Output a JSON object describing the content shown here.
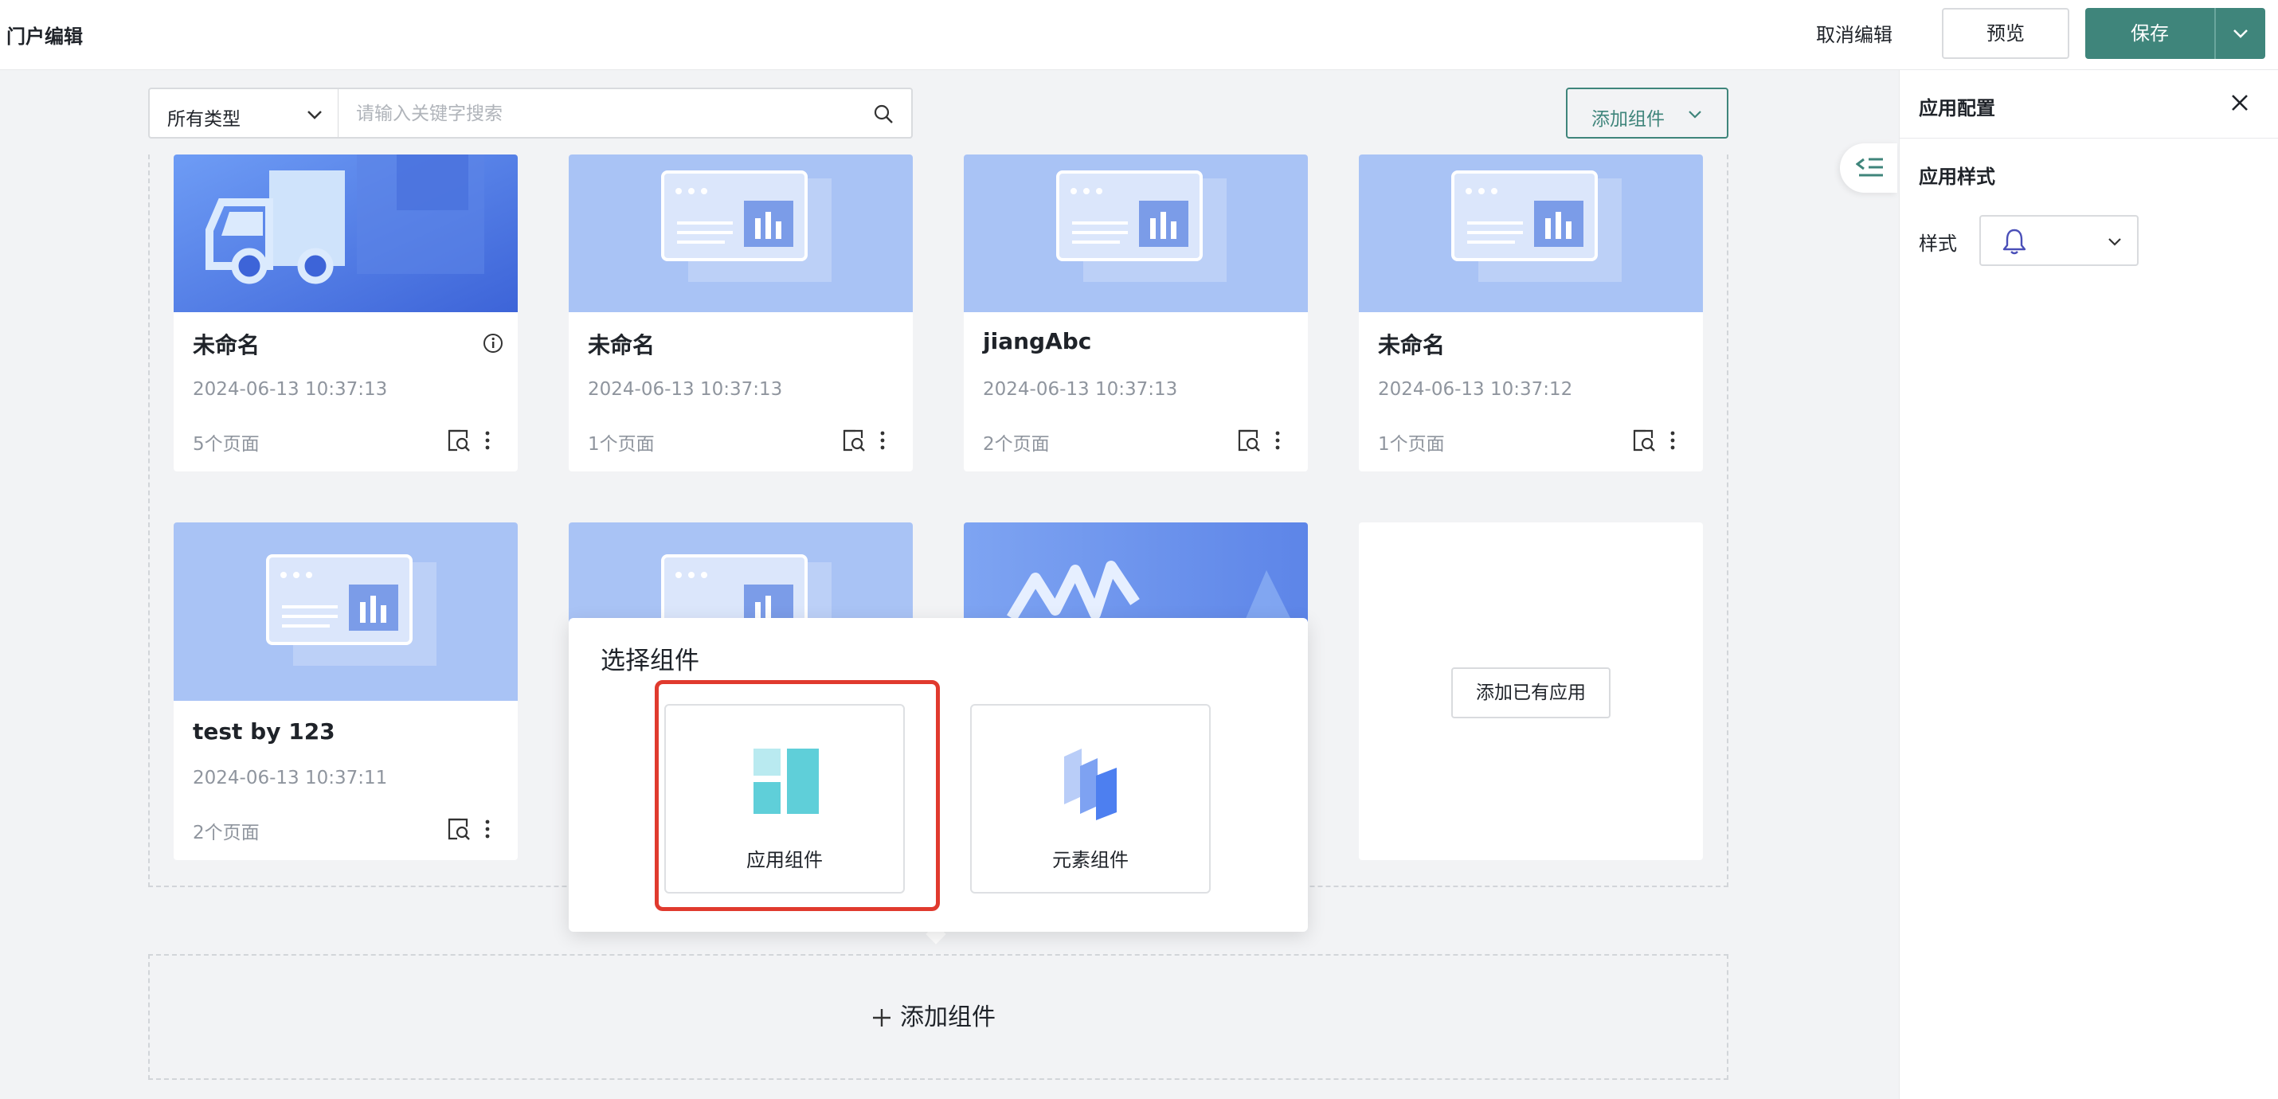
{
  "header": {
    "title": "门户编辑",
    "cancel_label": "取消编辑",
    "preview_label": "预览",
    "save_label": "保存"
  },
  "filter": {
    "type_selected": "所有类型",
    "search_placeholder": "请输入关键字搜索",
    "add_component_label": "添加组件"
  },
  "cards": [
    {
      "name": "未命名",
      "time": "2024-06-13 10:37:13",
      "pages": "5个页面",
      "thumb": "truck"
    },
    {
      "name": "未命名",
      "time": "2024-06-13 10:37:13",
      "pages": "1个页面",
      "thumb": "dashboard"
    },
    {
      "name": "jiangAbc",
      "time": "2024-06-13 10:37:13",
      "pages": "2个页面",
      "thumb": "dashboard"
    },
    {
      "name": "未命名",
      "time": "2024-06-13 10:37:12",
      "pages": "1个页面",
      "thumb": "dashboard"
    },
    {
      "name": "test by 123",
      "time": "2024-06-13 10:37:11",
      "pages": "2个页面",
      "thumb": "dashboard"
    }
  ],
  "add_existing_label": "添加已有应用",
  "add_area_label": "添加组件",
  "popover": {
    "title": "选择组件",
    "options": [
      {
        "label": "应用组件"
      },
      {
        "label": "元素组件"
      }
    ]
  },
  "panel": {
    "title": "应用配置",
    "section": "应用样式",
    "style_label": "样式",
    "style_icon": "bell-icon"
  },
  "colors": {
    "primary": "#3f857b",
    "highlight": "#e03a2e",
    "thumb_blue": "#a9c3f5"
  }
}
